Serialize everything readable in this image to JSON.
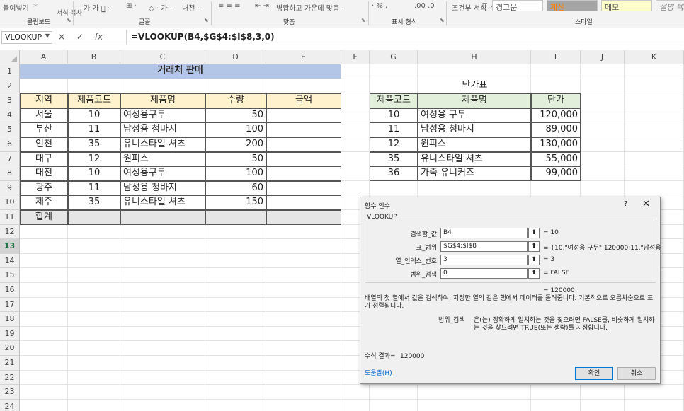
{
  "ribbon": {
    "paste_label": "붙여넣기",
    "format_painter": "서식 복사",
    "font_buttons": "가 가 가̲ ·",
    "border_btn": "⊞ ·",
    "fill_btn": "◇ · 가 ·",
    "phonetic_btn": "내천 ·",
    "align_btns": "≡ ≡ ≡",
    "indent_btns": "⇤ ⇥",
    "merge_label": "병합하고 가운데 맞춤 ·",
    "number_btns": "· % ,",
    "decimal_btns": ".00 .0",
    "conditional_label": "조건부 서식 ·",
    "table_label": "표 서식 ·",
    "style_bad": "경고문",
    "style_calc": "계산",
    "style_memo": "메모",
    "style_explain": "설명 텍스트",
    "groups": {
      "clipboard": "클립보드",
      "font": "글꼴",
      "align": "맞춤",
      "number": "표시 형식",
      "styles": "스타일"
    }
  },
  "formula_bar": {
    "name_box": "VLOOKUP",
    "cancel_icon": "×",
    "enter_icon": "✓",
    "fx_icon": "fx",
    "formula": "=VLOOKUP(B4,$G$4:$I$8,3,0)"
  },
  "columns": [
    "A",
    "B",
    "C",
    "D",
    "E",
    "F",
    "G",
    "H",
    "I",
    "J",
    "K"
  ],
  "rows": [
    "1",
    "2",
    "3",
    "4",
    "5",
    "6",
    "7",
    "8",
    "9",
    "10",
    "11",
    "12",
    "13",
    "14",
    "15",
    "16",
    "17",
    "18",
    "19",
    "20",
    "21",
    "22",
    "23",
    "24"
  ],
  "sheet": {
    "title": "거래처 판매",
    "headers": [
      "지역",
      "제품코드",
      "제품명",
      "수량",
      "금액"
    ],
    "data": [
      [
        "서울",
        "10",
        "여성용구두",
        "50",
        ""
      ],
      [
        "부산",
        "11",
        "남성용 청바지",
        "100",
        ""
      ],
      [
        "인천",
        "35",
        "유니스타일 셔츠",
        "200",
        ""
      ],
      [
        "대구",
        "12",
        "원피스",
        "50",
        ""
      ],
      [
        "대전",
        "10",
        "여성용구두",
        "100",
        ""
      ],
      [
        "광주",
        "11",
        "남성용 청바지",
        "60",
        ""
      ],
      [
        "제주",
        "35",
        "유니스타일 셔츠",
        "150",
        ""
      ]
    ],
    "total_label": "합계",
    "price_title": "단가표",
    "price_headers": [
      "제품코드",
      "제품명",
      "단가"
    ],
    "price_data": [
      [
        "10",
        "여성용 구두",
        "120,000"
      ],
      [
        "11",
        "남성용 청바지",
        "89,000"
      ],
      [
        "12",
        "원피스",
        "130,000"
      ],
      [
        "35",
        "유니스타일 셔츠",
        "55,000"
      ],
      [
        "36",
        "가죽 유니커즈",
        "99,000"
      ]
    ]
  },
  "dialog": {
    "title": "함수 인수",
    "help": "?",
    "close": "✕",
    "function_name": "VLOOKUP",
    "args": [
      {
        "label": "검색할_값",
        "value": "B4",
        "result": "=  10"
      },
      {
        "label": "표_범위",
        "value": "$G$4:$I$8",
        "result": "=  {10,\"여성용 구두\",120000;11,\"남성용"
      },
      {
        "label": "열_인덱스_번호",
        "value": "3",
        "result": "=  3"
      },
      {
        "label": "범위_검색",
        "value": "0",
        "result": "=  FALSE"
      }
    ],
    "arg_btn": "⬆",
    "overall_result": "=  120000",
    "description": "배열의 첫 열에서 값을 검색하여, 지정한 열의 같은 행에서 데이터를 돌려줍니다. 기본적으로 오름차순으로 표가 정렬됩니다.",
    "arg_help_label": "범위_검색",
    "arg_help_text": "은(는) 정확하게 일치하는 것을 찾으려면 FALSE를, 비슷하게 일치하는 것을 찾으려면 TRUE(또는 생략)를 지정합니다.",
    "formula_result_label": "수식 결과=",
    "formula_result_value": "120000",
    "help_link": "도움말(H)",
    "ok": "확인",
    "cancel": "취소"
  }
}
